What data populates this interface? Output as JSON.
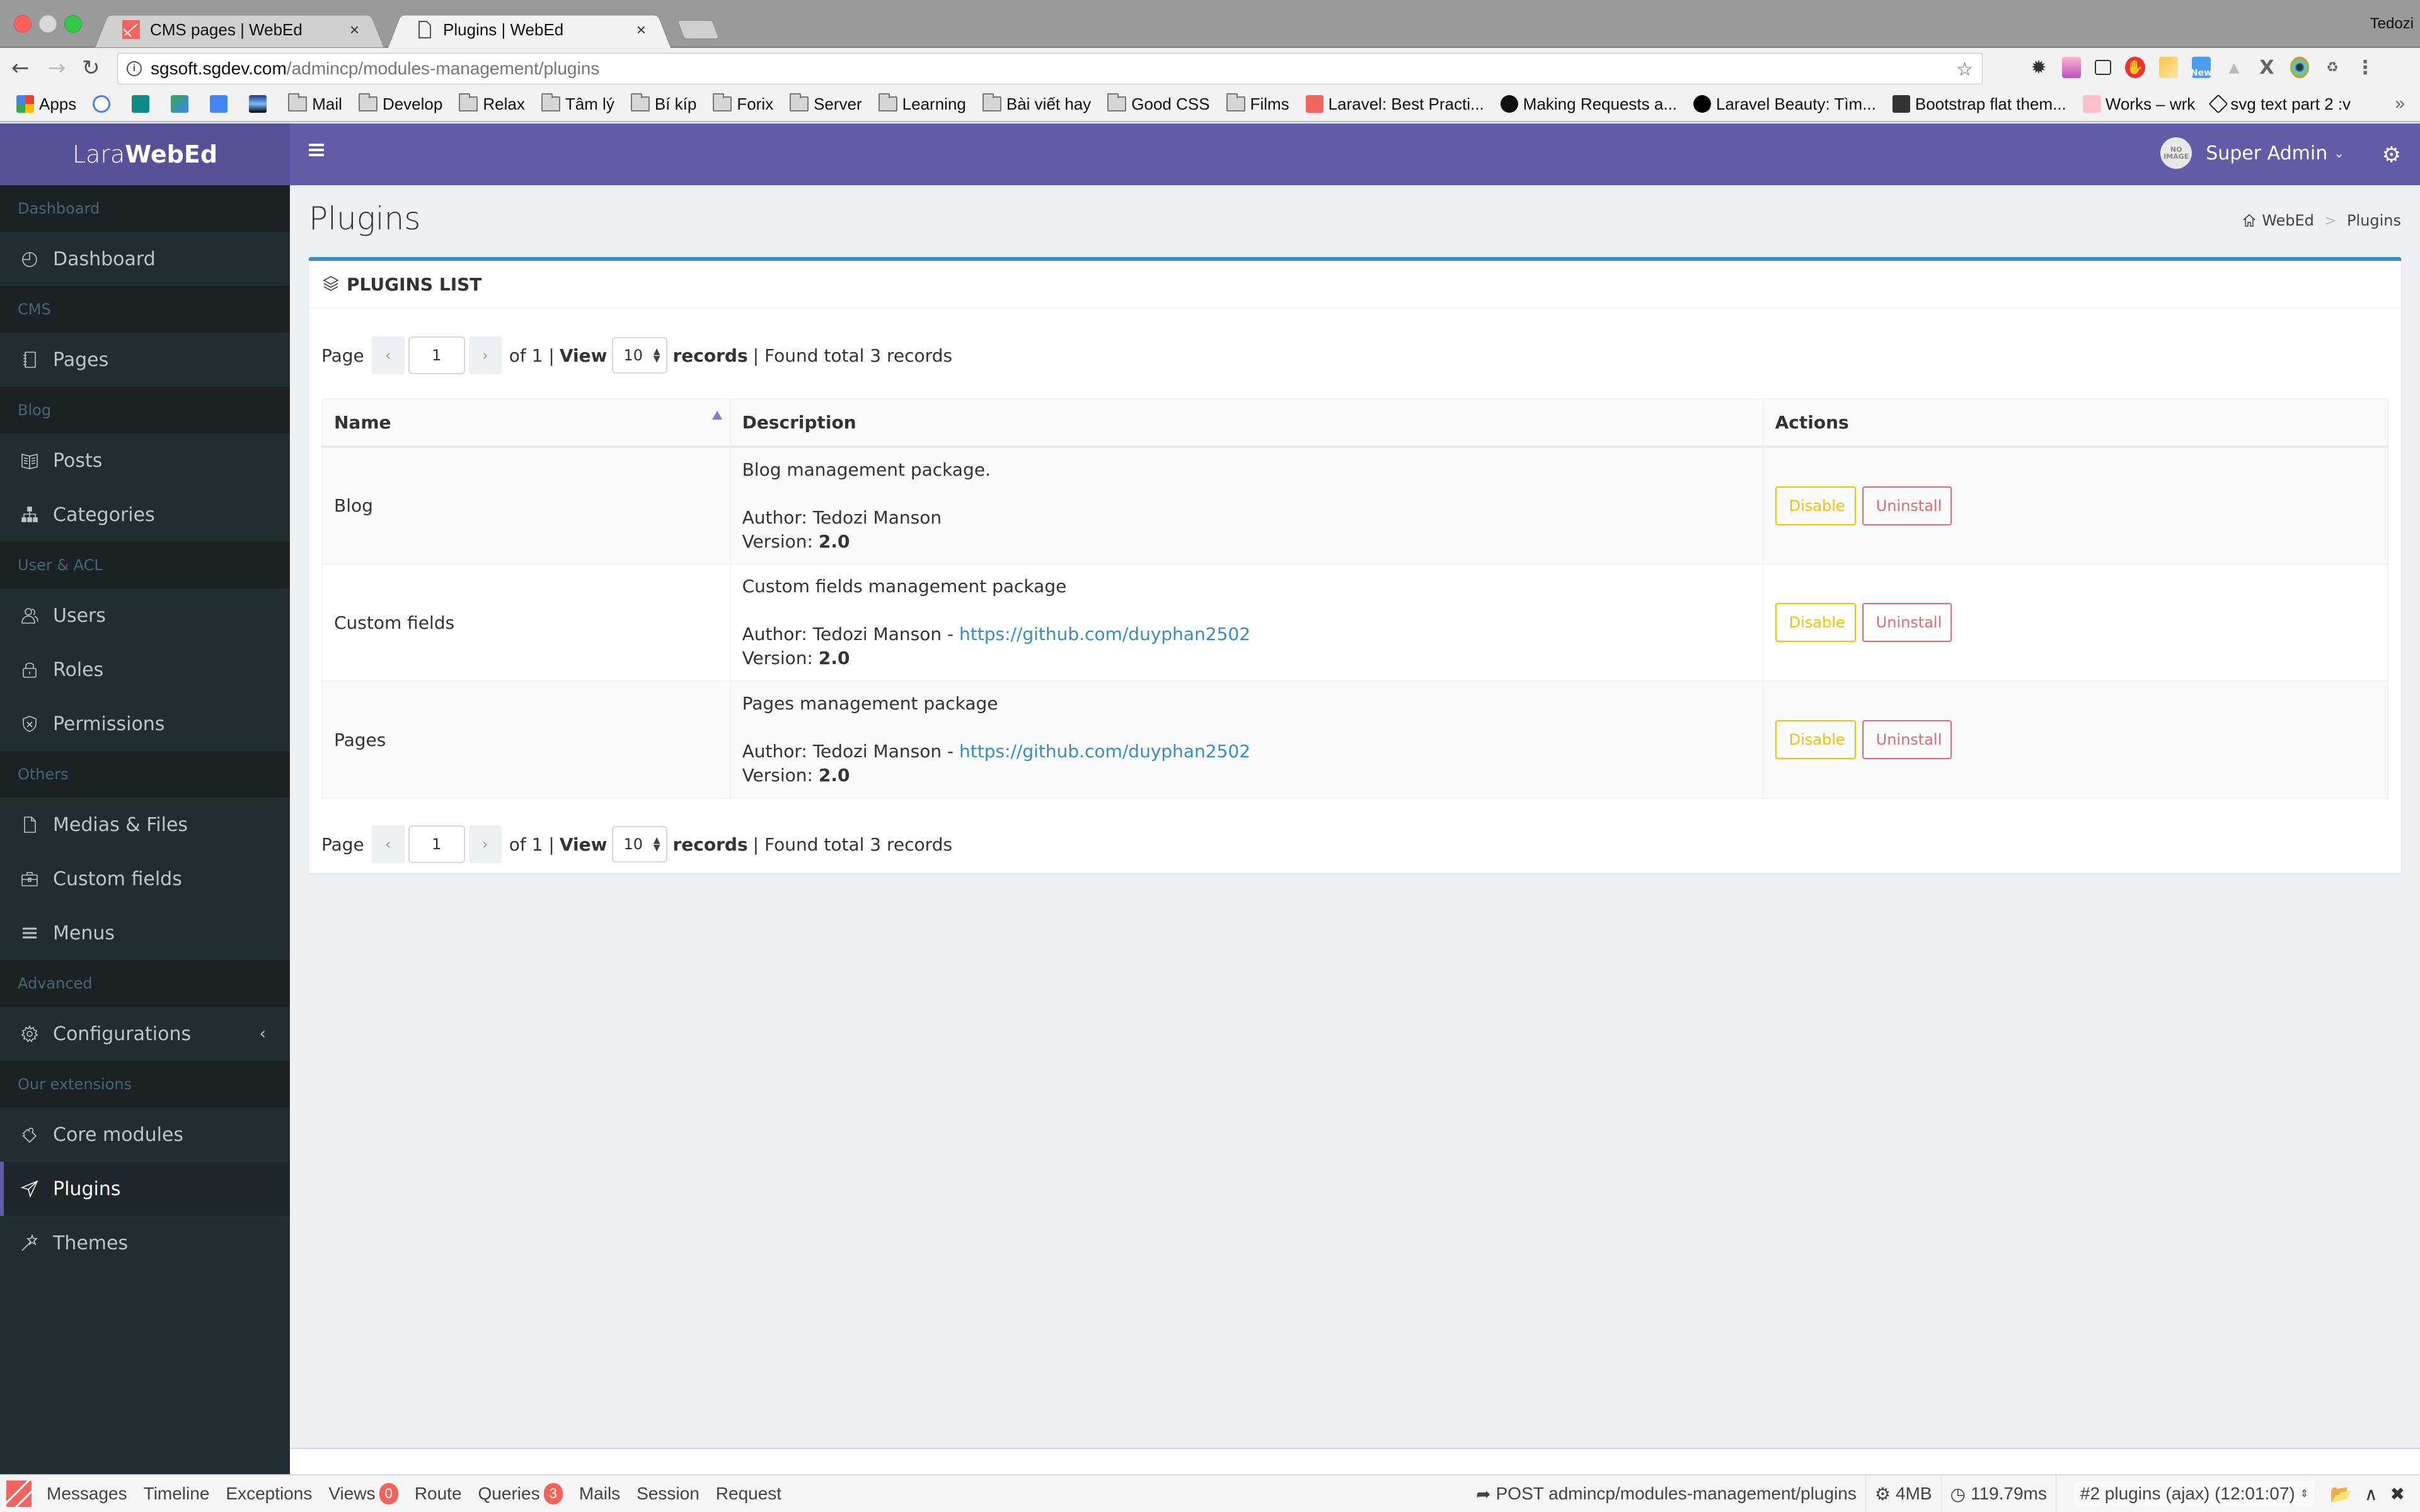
{
  "browser": {
    "tabs": [
      {
        "label": "CMS pages | WebEd",
        "active": false,
        "icon": "laravel-icon"
      },
      {
        "label": "Plugins | WebEd",
        "active": true,
        "icon": "page-icon"
      }
    ],
    "profile_name": "Tedozi",
    "url_host": "sgsoft.sgdev.com",
    "url_path": "/admincp/modules-management/plugins",
    "close_glyph": "×",
    "bookmarks": [
      {
        "label": "Apps",
        "type": "apps"
      },
      {
        "label": "",
        "type": "google"
      },
      {
        "label": "",
        "type": "bing"
      },
      {
        "label": "",
        "type": "translate"
      },
      {
        "label": "",
        "type": "google-translate"
      },
      {
        "label": "",
        "type": "image"
      },
      {
        "label": "Mail",
        "type": "folder"
      },
      {
        "label": "Develop",
        "type": "folder"
      },
      {
        "label": "Relax",
        "type": "folder"
      },
      {
        "label": "Tâm lý",
        "type": "folder"
      },
      {
        "label": "Bí kíp",
        "type": "folder"
      },
      {
        "label": "Forix",
        "type": "folder"
      },
      {
        "label": "Server",
        "type": "folder"
      },
      {
        "label": "Learning",
        "type": "folder"
      },
      {
        "label": "Bài viết hay",
        "type": "folder"
      },
      {
        "label": "Good CSS",
        "type": "folder"
      },
      {
        "label": "Films",
        "type": "folder"
      },
      {
        "label": "Laravel: Best Practi...",
        "type": "laravel"
      },
      {
        "label": "Making Requests a...",
        "type": "github"
      },
      {
        "label": "Laravel Beauty: Tìm...",
        "type": "v"
      },
      {
        "label": "Bootstrap flat them...",
        "type": "bootstrap"
      },
      {
        "label": "Works – wrk",
        "type": "w"
      },
      {
        "label": "svg text part 2 :v",
        "type": "codepen"
      }
    ],
    "bookmarks_more": "»",
    "extension_badge": "New"
  },
  "header": {
    "brand_light": "Lara",
    "brand_bold": "WebEd",
    "user_name": "Super Admin",
    "avatar_text": "NO IMAGE"
  },
  "sidebar": {
    "sections": [
      {
        "header": "Dashboard",
        "items": [
          {
            "label": "Dashboard",
            "icon": "dashboard-icon"
          }
        ]
      },
      {
        "header": "CMS",
        "items": [
          {
            "label": "Pages",
            "icon": "notebook-icon"
          }
        ]
      },
      {
        "header": "Blog",
        "items": [
          {
            "label": "Posts",
            "icon": "book-open-icon"
          },
          {
            "label": "Categories",
            "icon": "sitemap-icon"
          }
        ]
      },
      {
        "header": "User & ACL",
        "items": [
          {
            "label": "Users",
            "icon": "users-icon"
          },
          {
            "label": "Roles",
            "icon": "lock-icon"
          },
          {
            "label": "Permissions",
            "icon": "shield-icon"
          }
        ]
      },
      {
        "header": "Others",
        "items": [
          {
            "label": "Medias & Files",
            "icon": "file-icon"
          },
          {
            "label": "Custom fields",
            "icon": "briefcase-icon"
          },
          {
            "label": "Menus",
            "icon": "menu-icon"
          }
        ]
      },
      {
        "header": "Advanced",
        "items": [
          {
            "label": "Configurations",
            "icon": "gear-icon",
            "has_submenu": true
          }
        ]
      },
      {
        "header": "Our extensions",
        "items": [
          {
            "label": "Core modules",
            "icon": "puzzle-icon"
          },
          {
            "label": "Plugins",
            "icon": "paper-plane-icon",
            "active": true
          },
          {
            "label": "Themes",
            "icon": "magic-wand-icon"
          }
        ]
      }
    ]
  },
  "page": {
    "title": "Plugins",
    "breadcrumb": [
      "WebEd",
      "Plugins"
    ],
    "breadcrumb_sep": ">",
    "portlet_title": "PLUGINS LIST"
  },
  "pager": {
    "page_label": "Page",
    "current_page": "1",
    "of_label": "of 1 |",
    "view_label": "View",
    "per_page": "10",
    "records_label": "records",
    "found_label": "| Found total 3 records",
    "prev_glyph": "‹",
    "next_glyph": "›"
  },
  "table": {
    "columns": [
      "Name",
      "Description",
      "Actions"
    ],
    "author_label": "Author:",
    "version_label": "Version:",
    "rows": [
      {
        "name": "Blog",
        "description": "Blog management package.",
        "author": "Tedozi Manson",
        "link": "",
        "version": "2.0"
      },
      {
        "name": "Custom fields",
        "description": "Custom fields management package",
        "author": "Tedozi Manson",
        "link": "https://github.com/duyphan2502",
        "version": "2.0"
      },
      {
        "name": "Pages",
        "description": "Pages management package",
        "author": "Tedozi Manson",
        "link": "https://github.com/duyphan2502",
        "version": "2.0"
      }
    ],
    "disable_label": "Disable",
    "uninstall_label": "Uninstall"
  },
  "debugbar": {
    "tabs": [
      {
        "label": "Messages"
      },
      {
        "label": "Timeline"
      },
      {
        "label": "Exceptions"
      },
      {
        "label": "Views",
        "badge": "0"
      },
      {
        "label": "Route"
      },
      {
        "label": "Queries",
        "badge": "3"
      },
      {
        "label": "Mails"
      },
      {
        "label": "Session"
      },
      {
        "label": "Request"
      }
    ],
    "request": "POST admincp/modules-management/plugins",
    "memory": "4MB",
    "time": "119.79ms",
    "dataset": "#2 plugins (ajax) (12:01:07)"
  },
  "colors": {
    "header": "#605ca8",
    "brand": "#555299",
    "sidebar": "#222d32",
    "portlet_accent": "#3c8dbc",
    "disable": "#f3c200",
    "uninstall": "#e06c6c",
    "link": "#3a8dc1"
  }
}
